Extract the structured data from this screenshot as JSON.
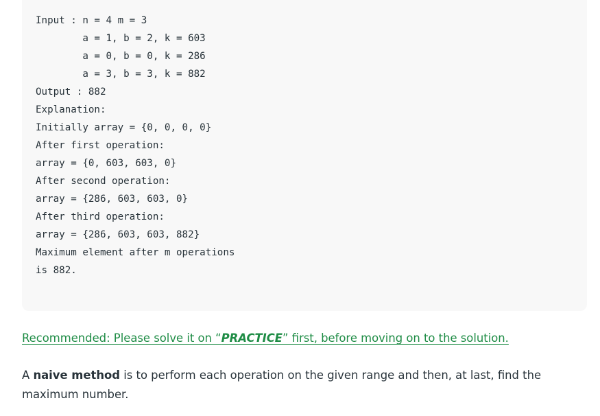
{
  "code_example": {
    "lines": [
      "Input : n = 4 m = 3",
      "        a = 1, b = 2, k = 603",
      "        a = 0, b = 0, k = 286",
      "        a = 3, b = 3, k = 882",
      "Output : 882",
      "Explanation:",
      "Initially array = {0, 0, 0, 0}",
      "After first operation:",
      "array = {0, 603, 603, 0}",
      "After second operation:",
      "array = {286, 603, 603, 0}",
      "After third operation:",
      "array = {286, 603, 603, 882}",
      "Maximum element after m operations",
      "is 882."
    ]
  },
  "recommendation": {
    "prefix": "Recommended: Please solve it on “",
    "practice": "PRACTICE",
    "suffix": "” first, before moving on to the solution."
  },
  "paragraph": {
    "prefix": "A ",
    "bold": "naive method",
    "suffix": " is to perform each operation on the given range and then, at last, find the maximum number."
  }
}
